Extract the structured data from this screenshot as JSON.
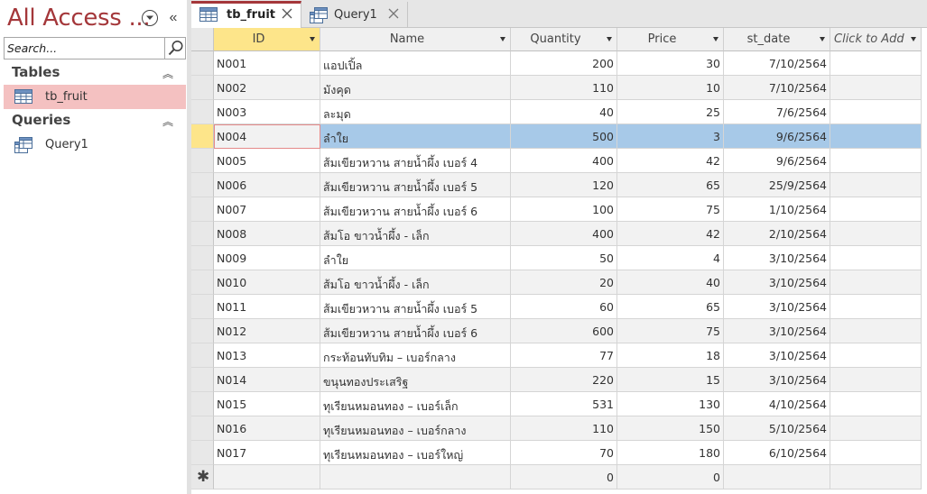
{
  "nav": {
    "title": "All Access ...",
    "search_placeholder": "Search...",
    "groups": [
      {
        "title": "Tables",
        "items": [
          {
            "label": "tb_fruit",
            "icon": "table-icon"
          }
        ]
      },
      {
        "title": "Queries",
        "items": [
          {
            "label": "Query1",
            "icon": "query-icon"
          }
        ]
      }
    ]
  },
  "tabs": [
    {
      "label": "tb_fruit",
      "icon": "table-icon",
      "active": true
    },
    {
      "label": "Query1",
      "icon": "query-icon",
      "active": false
    }
  ],
  "columns": [
    "ID",
    "Name",
    "Quantity",
    "Price",
    "st_date",
    "Click to Add"
  ],
  "rows": [
    {
      "id": "N001",
      "name": "แอปเปิ้ล",
      "qty": "200",
      "price": "30",
      "date": "7/10/2564"
    },
    {
      "id": "N002",
      "name": "มังคุด",
      "qty": "110",
      "price": "10",
      "date": "7/10/2564"
    },
    {
      "id": "N003",
      "name": "ละมุด",
      "qty": "40",
      "price": "25",
      "date": "7/6/2564"
    },
    {
      "id": "N004",
      "name": "ลำใย",
      "qty": "500",
      "price": "3",
      "date": "9/6/2564"
    },
    {
      "id": "N005",
      "name": "ส้มเขียวหวาน สายน้ำผึ้ง เบอร์ 4",
      "qty": "400",
      "price": "42",
      "date": "9/6/2564"
    },
    {
      "id": "N006",
      "name": "ส้มเขียวหวาน สายน้ำผึ้ง เบอร์ 5",
      "qty": "120",
      "price": "65",
      "date": "25/9/2564"
    },
    {
      "id": "N007",
      "name": "ส้มเขียวหวาน สายน้ำผึ้ง เบอร์ 6",
      "qty": "100",
      "price": "75",
      "date": "1/10/2564"
    },
    {
      "id": "N008",
      "name": "ส้มโอ ขาวน้ำผึ้ง - เล็ก",
      "qty": "400",
      "price": "42",
      "date": "2/10/2564"
    },
    {
      "id": "N009",
      "name": "ลำใย",
      "qty": "50",
      "price": "4",
      "date": "3/10/2564"
    },
    {
      "id": "N010",
      "name": "ส้มโอ ขาวน้ำผึ้ง - เล็ก",
      "qty": "20",
      "price": "40",
      "date": "3/10/2564"
    },
    {
      "id": "N011",
      "name": "ส้มเขียวหวาน สายน้ำผึ้ง เบอร์ 5",
      "qty": "60",
      "price": "65",
      "date": "3/10/2564"
    },
    {
      "id": "N012",
      "name": "ส้มเขียวหวาน สายน้ำผึ้ง เบอร์ 6",
      "qty": "600",
      "price": "75",
      "date": "3/10/2564"
    },
    {
      "id": "N013",
      "name": "กระท้อนทับทิม – เบอร์กลาง",
      "qty": "77",
      "price": "18",
      "date": "3/10/2564"
    },
    {
      "id": "N014",
      "name": "ขนุนทองประเสริฐ",
      "qty": "220",
      "price": "15",
      "date": "3/10/2564"
    },
    {
      "id": "N015",
      "name": "ทุเรียนหมอนทอง – เบอร์เล็ก",
      "qty": "531",
      "price": "130",
      "date": "4/10/2564"
    },
    {
      "id": "N016",
      "name": "ทุเรียนหมอนทอง – เบอร์กลาง",
      "qty": "110",
      "price": "150",
      "date": "5/10/2564"
    },
    {
      "id": "N017",
      "name": "ทุเรียนหมอนทอง – เบอร์ใหญ่",
      "qty": "70",
      "price": "180",
      "date": "6/10/2564"
    }
  ],
  "new_row": {
    "marker": "✱",
    "qty": "0",
    "price": "0"
  },
  "selected_row_index": 3,
  "colors": {
    "accent": "#a4373a",
    "selection": "#a7c9e8",
    "nav_selected": "#f4c1c1",
    "header_selected": "#fde58a"
  }
}
